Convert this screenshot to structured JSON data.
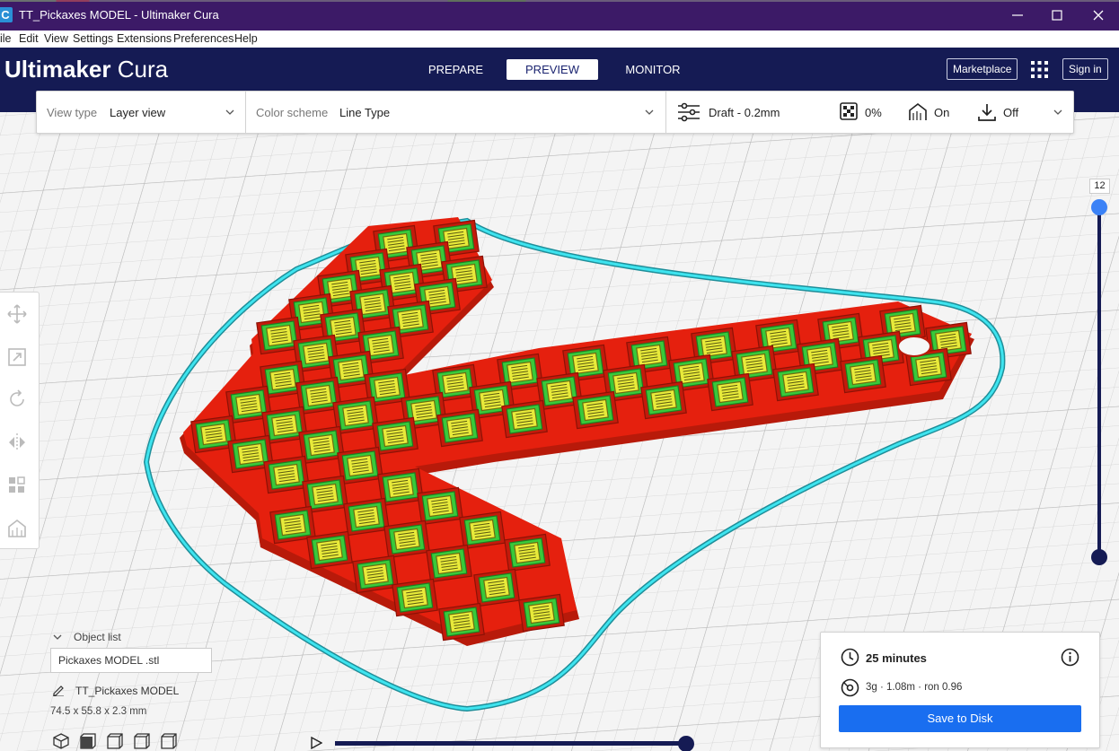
{
  "window": {
    "title": "TT_Pickaxes MODEL  - Ultimaker Cura",
    "app_icon_letter": "C"
  },
  "menu": [
    "ile",
    "Edit",
    "View",
    "Settings",
    "Extensions",
    "Preferences",
    "Help"
  ],
  "header": {
    "logo_bold": "Ultimaker",
    "logo_light": "Cura",
    "stages": [
      "PREPARE",
      "PREVIEW",
      "MONITOR"
    ],
    "active_stage": "PREVIEW",
    "marketplace_label": "Marketplace",
    "signin_label": "Sign in"
  },
  "toolbar": {
    "view_type_label": "View type",
    "view_type_value": "Layer view",
    "color_scheme_label": "Color scheme",
    "color_scheme_value": "Line Type",
    "profile": "Draft - 0.2mm",
    "infill": "0%",
    "support": "On",
    "adhesion": "Off"
  },
  "layer_slider": {
    "current_layer": "12"
  },
  "object_list": {
    "header": "Object list",
    "file": "Pickaxes MODEL .stl",
    "object_name": "TT_Pickaxes MODEL",
    "dimensions": "74.5 x 55.8 x 2.3 mm"
  },
  "print_info": {
    "time": "25 minutes",
    "material": "3g · 1.08m · ron 0.96",
    "save_label": "Save to Disk"
  },
  "colors": {
    "header_bg": "#151b54",
    "titlebar_bg": "#3c1a67",
    "accent_blue": "#196ef0",
    "wall_red": "#e5200e",
    "skin_yellow": "#e8ea3a",
    "inner_green": "#39c93a",
    "skirt_cyan": "#36d4e0"
  },
  "icons": [
    "move-icon",
    "scale-icon",
    "rotate-icon",
    "mirror-icon",
    "per-model-settings-icon",
    "support-blocker-icon",
    "clock-icon",
    "info-icon",
    "spool-icon",
    "settings-sliders-icon",
    "infill-icon",
    "support-icon",
    "adhesion-icon"
  ]
}
